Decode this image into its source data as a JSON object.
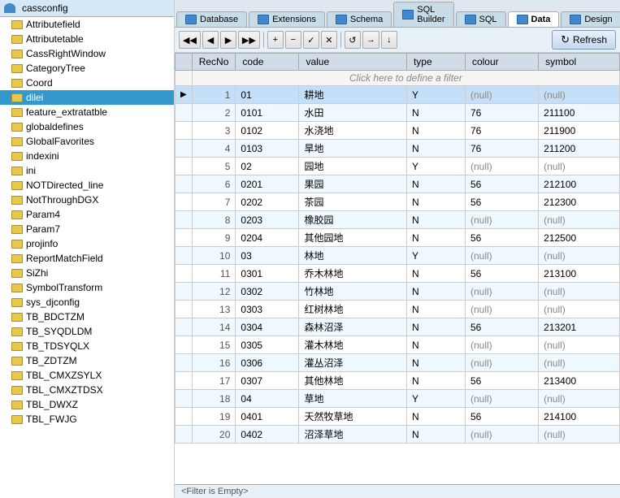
{
  "sidebar": {
    "title": "cassconfig",
    "items": [
      {
        "label": "Attributefield",
        "selected": false
      },
      {
        "label": "Attributetable",
        "selected": false
      },
      {
        "label": "CassRightWindow",
        "selected": false
      },
      {
        "label": "CategoryTree",
        "selected": false
      },
      {
        "label": "Coord",
        "selected": false
      },
      {
        "label": "dilei",
        "selected": true
      },
      {
        "label": "feature_extratatble",
        "selected": false
      },
      {
        "label": "globaldefines",
        "selected": false
      },
      {
        "label": "GlobalFavorites",
        "selected": false
      },
      {
        "label": "indexini",
        "selected": false
      },
      {
        "label": "ini",
        "selected": false
      },
      {
        "label": "NOTDirected_line",
        "selected": false
      },
      {
        "label": "NotThroughDGX",
        "selected": false
      },
      {
        "label": "Param4",
        "selected": false
      },
      {
        "label": "Param7",
        "selected": false
      },
      {
        "label": "projinfo",
        "selected": false
      },
      {
        "label": "ReportMatchField",
        "selected": false
      },
      {
        "label": "SiZhi",
        "selected": false
      },
      {
        "label": "SymbolTransform",
        "selected": false
      },
      {
        "label": "sys_djconfig",
        "selected": false
      },
      {
        "label": "TB_BDCTZM",
        "selected": false
      },
      {
        "label": "TB_SYQDLDM",
        "selected": false
      },
      {
        "label": "TB_TDSYQLX",
        "selected": false
      },
      {
        "label": "TB_ZDTZM",
        "selected": false
      },
      {
        "label": "TBL_CMXZSYLX",
        "selected": false
      },
      {
        "label": "TBL_CMXZTDSX",
        "selected": false
      },
      {
        "label": "TBL_DWXZ",
        "selected": false
      },
      {
        "label": "TBL_FWJG",
        "selected": false
      }
    ]
  },
  "tabs": [
    {
      "label": "Database",
      "active": false
    },
    {
      "label": "Extensions",
      "active": false
    },
    {
      "label": "Schema",
      "active": false
    },
    {
      "label": "SQL Builder",
      "active": false
    },
    {
      "label": "SQL",
      "active": false
    },
    {
      "label": "Data",
      "active": true
    },
    {
      "label": "Design",
      "active": false
    }
  ],
  "toolbar": {
    "refresh_label": "Refresh",
    "nav_buttons": [
      "◀◀",
      "◀",
      "▶",
      "▶▶",
      "+",
      "−",
      "✓",
      "✕",
      "↺",
      "→",
      "↓"
    ],
    "filter_placeholder": "<Filter is Empty>"
  },
  "table": {
    "columns": [
      "RecNo",
      "code",
      "value",
      "type",
      "colour",
      "symbol"
    ],
    "filter_row": "Click here to define a filter",
    "rows": [
      {
        "recno": 1,
        "code": "01",
        "value": "耕地",
        "type": "Y",
        "colour": "(null)",
        "symbol": "(null)",
        "selected": true
      },
      {
        "recno": 2,
        "code": "0101",
        "value": "水田",
        "type": "N",
        "colour": "76",
        "symbol": "211100",
        "selected": false
      },
      {
        "recno": 3,
        "code": "0102",
        "value": "水浇地",
        "type": "N",
        "colour": "76",
        "symbol": "211900",
        "selected": false
      },
      {
        "recno": 4,
        "code": "0103",
        "value": "旱地",
        "type": "N",
        "colour": "76",
        "symbol": "211200",
        "selected": false
      },
      {
        "recno": 5,
        "code": "02",
        "value": "园地",
        "type": "Y",
        "colour": "(null)",
        "symbol": "(null)",
        "selected": false
      },
      {
        "recno": 6,
        "code": "0201",
        "value": "果园",
        "type": "N",
        "colour": "56",
        "symbol": "212100",
        "selected": false
      },
      {
        "recno": 7,
        "code": "0202",
        "value": "茶园",
        "type": "N",
        "colour": "56",
        "symbol": "212300",
        "selected": false
      },
      {
        "recno": 8,
        "code": "0203",
        "value": "橡胶园",
        "type": "N",
        "colour": "(null)",
        "symbol": "(null)",
        "selected": false
      },
      {
        "recno": 9,
        "code": "0204",
        "value": "其他园地",
        "type": "N",
        "colour": "56",
        "symbol": "212500",
        "selected": false
      },
      {
        "recno": 10,
        "code": "03",
        "value": "林地",
        "type": "Y",
        "colour": "(null)",
        "symbol": "(null)",
        "selected": false
      },
      {
        "recno": 11,
        "code": "0301",
        "value": "乔木林地",
        "type": "N",
        "colour": "56",
        "symbol": "213100",
        "selected": false
      },
      {
        "recno": 12,
        "code": "0302",
        "value": "竹林地",
        "type": "N",
        "colour": "(null)",
        "symbol": "(null)",
        "selected": false
      },
      {
        "recno": 13,
        "code": "0303",
        "value": "红树林地",
        "type": "N",
        "colour": "(null)",
        "symbol": "(null)",
        "selected": false
      },
      {
        "recno": 14,
        "code": "0304",
        "value": "森林沼泽",
        "type": "N",
        "colour": "56",
        "symbol": "213201",
        "selected": false
      },
      {
        "recno": 15,
        "code": "0305",
        "value": "灌木林地",
        "type": "N",
        "colour": "(null)",
        "symbol": "(null)",
        "selected": false
      },
      {
        "recno": 16,
        "code": "0306",
        "value": "灌丛沼泽",
        "type": "N",
        "colour": "(null)",
        "symbol": "(null)",
        "selected": false
      },
      {
        "recno": 17,
        "code": "0307",
        "value": "其他林地",
        "type": "N",
        "colour": "56",
        "symbol": "213400",
        "selected": false
      },
      {
        "recno": 18,
        "code": "04",
        "value": "草地",
        "type": "Y",
        "colour": "(null)",
        "symbol": "(null)",
        "selected": false
      },
      {
        "recno": 19,
        "code": "0401",
        "value": "天然牧草地",
        "type": "N",
        "colour": "56",
        "symbol": "214100",
        "selected": false
      },
      {
        "recno": 20,
        "code": "0402",
        "value": "沼泽草地",
        "type": "N",
        "colour": "(null)",
        "symbol": "(null)",
        "selected": false
      }
    ]
  },
  "status": {
    "filter_empty": "<Filter is Empty>"
  },
  "colors": {
    "selected_row": "#c4dff7",
    "even_row": "#f0f8ff",
    "odd_row": "#ffffff",
    "header_bg": "#d0dce8",
    "tab_active_bg": "#ffffff",
    "tab_inactive_bg": "#c8dce8"
  }
}
